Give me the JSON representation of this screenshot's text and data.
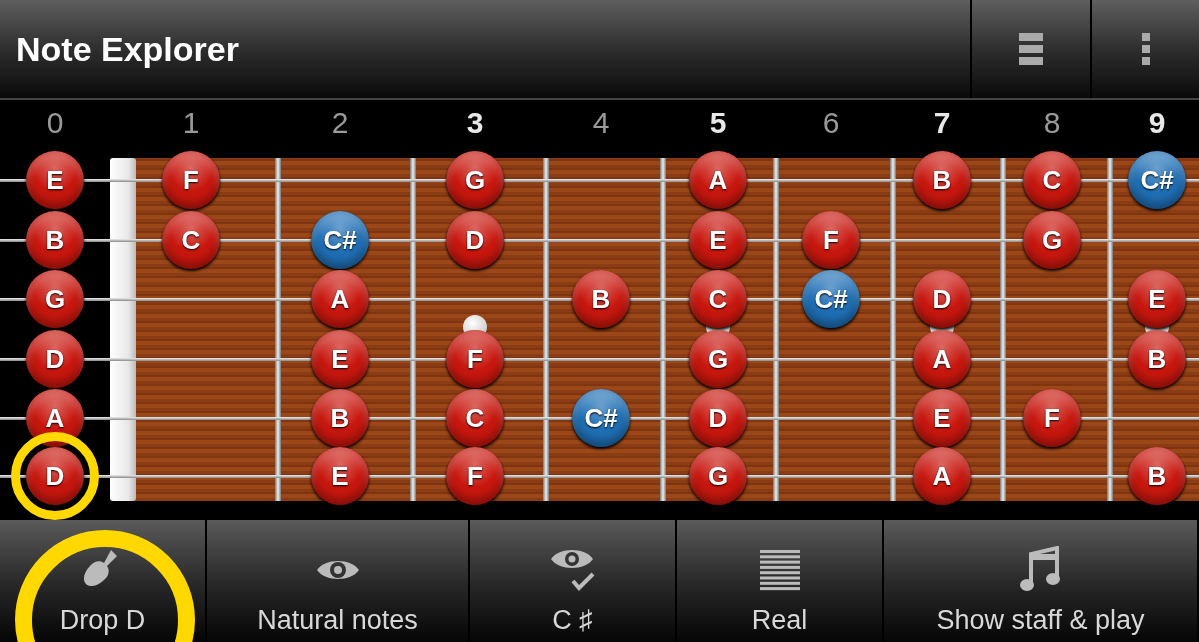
{
  "app_bar": {
    "title": "Note Explorer"
  },
  "frets": [
    {
      "label": "0",
      "marked": false
    },
    {
      "label": "1",
      "marked": false
    },
    {
      "label": "2",
      "marked": false
    },
    {
      "label": "3",
      "marked": true
    },
    {
      "label": "4",
      "marked": false
    },
    {
      "label": "5",
      "marked": true
    },
    {
      "label": "6",
      "marked": false
    },
    {
      "label": "7",
      "marked": true
    },
    {
      "label": "8",
      "marked": false
    },
    {
      "label": "9",
      "marked": true
    }
  ],
  "strings": [
    {
      "cells": [
        {
          "note": "E",
          "color": "#c8170e",
          "highlighted": false
        },
        {
          "note": "F",
          "color": "#c8170e",
          "highlighted": false
        },
        null,
        {
          "note": "G",
          "color": "#c8170e",
          "highlighted": false
        },
        null,
        {
          "note": "A",
          "color": "#c8170e",
          "highlighted": false
        },
        null,
        {
          "note": "B",
          "color": "#c8170e",
          "highlighted": false
        },
        {
          "note": "C",
          "color": "#c8170e",
          "highlighted": false
        },
        {
          "note": "C#",
          "color": "#1f6fb5",
          "highlighted": false
        }
      ]
    },
    {
      "cells": [
        {
          "note": "B",
          "color": "#c8170e",
          "highlighted": false
        },
        {
          "note": "C",
          "color": "#c8170e",
          "highlighted": false
        },
        {
          "note": "C#",
          "color": "#1f6fb5",
          "highlighted": false
        },
        {
          "note": "D",
          "color": "#c8170e",
          "highlighted": false
        },
        null,
        {
          "note": "E",
          "color": "#c8170e",
          "highlighted": false
        },
        {
          "note": "F",
          "color": "#c8170e",
          "highlighted": false
        },
        null,
        {
          "note": "G",
          "color": "#c8170e",
          "highlighted": false
        },
        null
      ]
    },
    {
      "cells": [
        {
          "note": "G",
          "color": "#c8170e",
          "highlighted": false
        },
        null,
        {
          "note": "A",
          "color": "#c8170e",
          "highlighted": false
        },
        null,
        {
          "note": "B",
          "color": "#c8170e",
          "highlighted": false
        },
        {
          "note": "C",
          "color": "#c8170e",
          "highlighted": false
        },
        {
          "note": "C#",
          "color": "#1f6fb5",
          "highlighted": false
        },
        {
          "note": "D",
          "color": "#c8170e",
          "highlighted": false
        },
        null,
        {
          "note": "E",
          "color": "#c8170e",
          "highlighted": false
        }
      ]
    },
    {
      "cells": [
        {
          "note": "D",
          "color": "#c8170e",
          "highlighted": false
        },
        null,
        {
          "note": "E",
          "color": "#c8170e",
          "highlighted": false
        },
        {
          "note": "F",
          "color": "#c8170e",
          "highlighted": false
        },
        null,
        {
          "note": "G",
          "color": "#c8170e",
          "highlighted": false
        },
        null,
        {
          "note": "A",
          "color": "#c8170e",
          "highlighted": false
        },
        null,
        {
          "note": "B",
          "color": "#c8170e",
          "highlighted": false
        }
      ]
    },
    {
      "cells": [
        {
          "note": "A",
          "color": "#c8170e",
          "highlighted": false
        },
        null,
        {
          "note": "B",
          "color": "#c8170e",
          "highlighted": false
        },
        {
          "note": "C",
          "color": "#c8170e",
          "highlighted": false
        },
        {
          "note": "C#",
          "color": "#1f6fb5",
          "highlighted": false
        },
        {
          "note": "D",
          "color": "#c8170e",
          "highlighted": false
        },
        null,
        {
          "note": "E",
          "color": "#c8170e",
          "highlighted": false
        },
        {
          "note": "F",
          "color": "#c8170e",
          "highlighted": false
        },
        null
      ]
    },
    {
      "cells": [
        {
          "note": "D",
          "color": "#c8170e",
          "highlighted": true
        },
        null,
        {
          "note": "E",
          "color": "#c8170e",
          "highlighted": false
        },
        {
          "note": "F",
          "color": "#c8170e",
          "highlighted": false
        },
        null,
        {
          "note": "G",
          "color": "#c8170e",
          "highlighted": false
        },
        null,
        {
          "note": "A",
          "color": "#c8170e",
          "highlighted": false
        },
        null,
        {
          "note": "B",
          "color": "#c8170e",
          "highlighted": false
        }
      ]
    }
  ],
  "toolbar": [
    {
      "label": "Drop D",
      "highlighted": true
    },
    {
      "label": "Natural notes",
      "highlighted": false
    },
    {
      "label": "C ♯",
      "highlighted": false
    },
    {
      "label": "Real",
      "highlighted": false
    },
    {
      "label": "Show staff & play",
      "highlighted": false
    }
  ]
}
